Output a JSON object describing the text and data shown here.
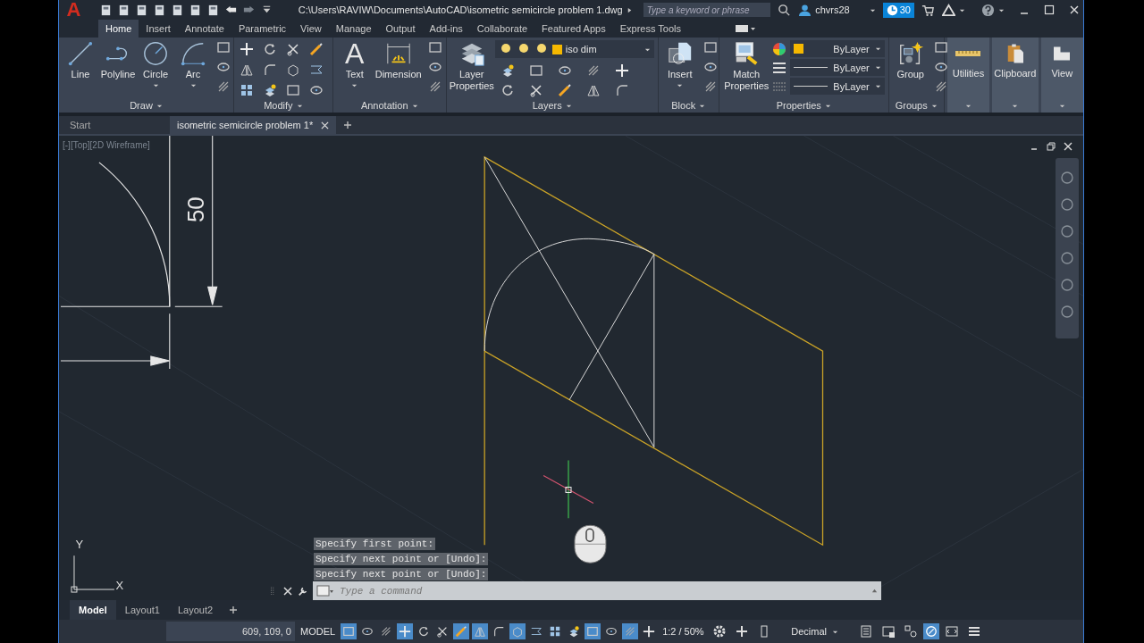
{
  "title_bar": {
    "logo": "A",
    "path": "C:\\Users\\RAVIW\\Documents\\AutoCAD\\isometric semicircle problem 1.dwg",
    "search": {
      "placeholder": "Type a keyword or phrase"
    },
    "user": "chvrs28",
    "badge": "30"
  },
  "ribbon_tabs": [
    {
      "label": "Home",
      "selected": true
    },
    {
      "label": "Insert",
      "selected": false
    },
    {
      "label": "Annotate",
      "selected": false
    },
    {
      "label": "Parametric",
      "selected": false
    },
    {
      "label": "View",
      "selected": false
    },
    {
      "label": "Manage",
      "selected": false
    },
    {
      "label": "Output",
      "selected": false
    },
    {
      "label": "Add-ins",
      "selected": false
    },
    {
      "label": "Collaborate",
      "selected": false
    },
    {
      "label": "Featured Apps",
      "selected": false
    },
    {
      "label": "Express Tools",
      "selected": false
    }
  ],
  "ribbon_panels": [
    {
      "title": "Draw",
      "kind": "draw",
      "tools": [
        {
          "label": "Line",
          "menu": false
        },
        {
          "label": "Polyline",
          "menu": false
        },
        {
          "label": "Circle",
          "menu": true
        },
        {
          "label": "Arc",
          "menu": true
        }
      ]
    },
    {
      "title": "Modify",
      "kind": "modify"
    },
    {
      "title": "Annotation",
      "kind": "annotation",
      "tools": [
        {
          "label": "Text",
          "menu": true,
          "glyph": "A"
        },
        {
          "label": "Dimension",
          "menu": false
        }
      ]
    },
    {
      "title": "Layers",
      "kind": "layers",
      "tools": [
        {
          "label": "Layer Properties",
          "menu": false
        }
      ],
      "layer": {
        "name": "iso dim",
        "color": "#f5b800"
      }
    },
    {
      "title": "Block",
      "kind": "block",
      "tools": [
        {
          "label": "Insert",
          "menu": true
        }
      ]
    },
    {
      "title": "Properties",
      "kind": "properties",
      "tools": [
        {
          "label": "Match Properties",
          "menu": false
        }
      ],
      "dropdowns": [
        {
          "kind": "color",
          "value": "ByLayer",
          "color": "#f5b800"
        },
        {
          "kind": "linetype",
          "value": "ByLayer"
        },
        {
          "kind": "lineweight",
          "value": "ByLayer"
        }
      ]
    },
    {
      "title": "Groups",
      "kind": "groups",
      "tools": [
        {
          "label": "Group",
          "menu": false
        }
      ]
    }
  ],
  "collapsed_panels": [
    {
      "title": "Utilities",
      "kind": "utilities"
    },
    {
      "title": "Clipboard",
      "kind": "clipboard"
    },
    {
      "title": "View",
      "kind": "view"
    }
  ],
  "file_tabs": [
    {
      "label": "Start",
      "selected": false,
      "closable": false
    },
    {
      "label": "isometric semicircle problem 1*",
      "selected": true,
      "closable": true
    }
  ],
  "viewport": {
    "label": "[-][Top][2D Wireframe]",
    "dimension": "50",
    "axis_labels": [
      "Y",
      "X"
    ],
    "history": [
      "Specify first point:",
      "Specify next point or [Undo]:",
      "Specify next point or [Undo]:"
    ],
    "command": {
      "placeholder": "Type a command"
    }
  },
  "layout_tabs": [
    {
      "label": "Model",
      "selected": true
    },
    {
      "label": "Layout1",
      "selected": false
    },
    {
      "label": "Layout2",
      "selected": false
    }
  ],
  "status_bar": {
    "coordinates": "609, 109, 0",
    "space": "MODEL",
    "toggles": [
      {
        "on": true
      },
      {
        "on": false
      },
      {
        "on": false
      },
      {
        "on": true
      },
      {
        "on": false
      },
      {
        "on": false
      },
      {
        "on": true
      },
      {
        "on": true
      },
      {
        "on": false
      },
      {
        "on": true
      },
      {
        "on": false
      },
      {
        "on": false
      },
      {
        "on": false
      },
      {
        "on": true
      },
      {
        "on": false
      },
      {
        "on": true
      },
      {
        "on": false
      }
    ],
    "scale": "1:2 / 50%",
    "units": "Decimal"
  }
}
